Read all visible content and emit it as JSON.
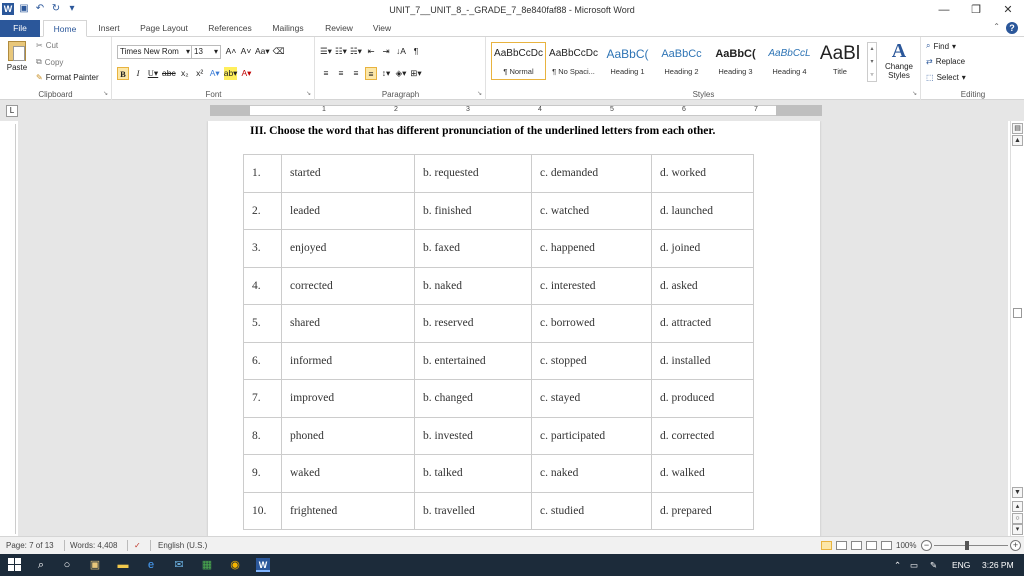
{
  "app": {
    "title": "UNIT_7__UNIT_8_-_GRADE_7_8e840faf88  -  Microsoft Word",
    "window_controls": {
      "minimize": "—",
      "restore": "❐",
      "close": "✕"
    }
  },
  "tabs": [
    {
      "label": "File"
    },
    {
      "label": "Home"
    },
    {
      "label": "Insert"
    },
    {
      "label": "Page Layout"
    },
    {
      "label": "References"
    },
    {
      "label": "Mailings"
    },
    {
      "label": "Review"
    },
    {
      "label": "View"
    }
  ],
  "ribbon": {
    "clipboard": {
      "paste": "Paste",
      "cut": "Cut",
      "copy": "Copy",
      "format_painter": "Format Painter",
      "label": "Clipboard"
    },
    "font": {
      "name": "Times New Rom",
      "size": "13",
      "label": "Font"
    },
    "paragraph": {
      "label": "Paragraph"
    },
    "styles": {
      "label": "Styles",
      "items": [
        {
          "sample": "AaBbCcDc",
          "name": "¶ Normal"
        },
        {
          "sample": "AaBbCcDc",
          "name": "¶ No Spaci..."
        },
        {
          "sample": "AaBbC(",
          "name": "Heading 1"
        },
        {
          "sample": "AaBbCc",
          "name": "Heading 2"
        },
        {
          "sample": "AaBbC(",
          "name": "Heading 3"
        },
        {
          "sample": "AaBbCcL",
          "name": "Heading 4"
        },
        {
          "sample": "AaBl",
          "name": "Title"
        }
      ],
      "change_styles": "Change Styles"
    },
    "editing": {
      "find": "Find",
      "replace": "Replace",
      "select": "Select",
      "label": "Editing"
    }
  },
  "ruler": {
    "numbers": [
      "1",
      "2",
      "3",
      "4",
      "5",
      "6",
      "7"
    ]
  },
  "document": {
    "heading": "III. Choose the word that has different pronunciation of the underlined letters from each other.",
    "rows": [
      {
        "num": "1.",
        "a": "started",
        "b": "b. requested",
        "c": "c. demanded",
        "d": "d. worked"
      },
      {
        "num": "2.",
        "a": "leaded",
        "b": "b. finished",
        "c": "c. watched",
        "d": "d. launched"
      },
      {
        "num": "3.",
        "a": "enjoyed",
        "b": "b. faxed",
        "c": "c. happened",
        "d": "d. joined"
      },
      {
        "num": "4.",
        "a": "corrected",
        "b": "b. naked",
        "c": "c. interested",
        "d": "d. asked"
      },
      {
        "num": "5.",
        "a": "shared",
        "b": "b. reserved",
        "c": "c. borrowed",
        "d": "d. attracted"
      },
      {
        "num": "6.",
        "a": "informed",
        "b": "b. entertained",
        "c": "c. stopped",
        "d": "d. installed"
      },
      {
        "num": "7.",
        "a": "improved",
        "b": "b. changed",
        "c": "c. stayed",
        "d": "d. produced"
      },
      {
        "num": "8.",
        "a": "phoned",
        "b": "b. invested",
        "c": "c. participated",
        "d": "d. corrected"
      },
      {
        "num": "9.",
        "a": "waked",
        "b": "b. talked",
        "c": "c. naked",
        "d": "d. walked"
      },
      {
        "num": "10.",
        "a": "frightened",
        "b": "b. travelled",
        "c": "c. studied",
        "d": "d. prepared"
      }
    ]
  },
  "status": {
    "page": "Page: 7 of 13",
    "words": "Words: 4,408",
    "language": "English (U.S.)",
    "zoom": "100%"
  },
  "taskbar": {
    "language": "ENG",
    "time": "3:26 PM"
  },
  "colors": {
    "accent": "#2b579a",
    "taskbar": "#1c2b3a",
    "highlight": "#fce7a8"
  }
}
